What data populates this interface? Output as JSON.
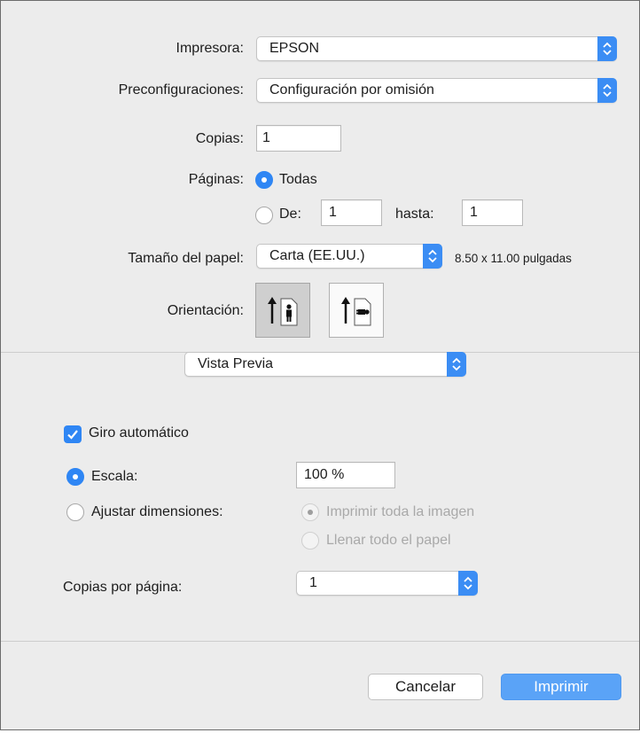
{
  "printer": {
    "label": "Impresora:",
    "value": "EPSON"
  },
  "presets": {
    "label": "Preconfiguraciones:",
    "value": "Configuración por omisión"
  },
  "copies": {
    "label": "Copias:",
    "value": "1"
  },
  "pages": {
    "label": "Páginas:",
    "all_label": "Todas",
    "from_label": "De:",
    "from_value": "1",
    "to_label": "hasta:",
    "to_value": "1",
    "selected": "all"
  },
  "paper_size": {
    "label": "Tamaño del papel:",
    "value": "Carta (EE.UU.)",
    "dimensions": "8.50 x 11.00 pulgadas"
  },
  "orientation": {
    "label": "Orientación:",
    "selected": "portrait"
  },
  "section_popup": {
    "value": "Vista Previa"
  },
  "auto_rotate": {
    "label": "Giro automático",
    "checked": true
  },
  "scale": {
    "label": "Escala:",
    "value": "100 %",
    "selected": true
  },
  "fit": {
    "label": "Ajustar dimensiones:",
    "option_print_entire": "Imprimir toda la imagen",
    "option_fill_paper": "Llenar todo el papel"
  },
  "copies_per_page": {
    "label": "Copias por página:",
    "value": "1"
  },
  "buttons": {
    "cancel": "Cancelar",
    "print": "Imprimir"
  },
  "colors": {
    "accent": "#2f86f4",
    "primary_button": "#5aa3f7"
  }
}
